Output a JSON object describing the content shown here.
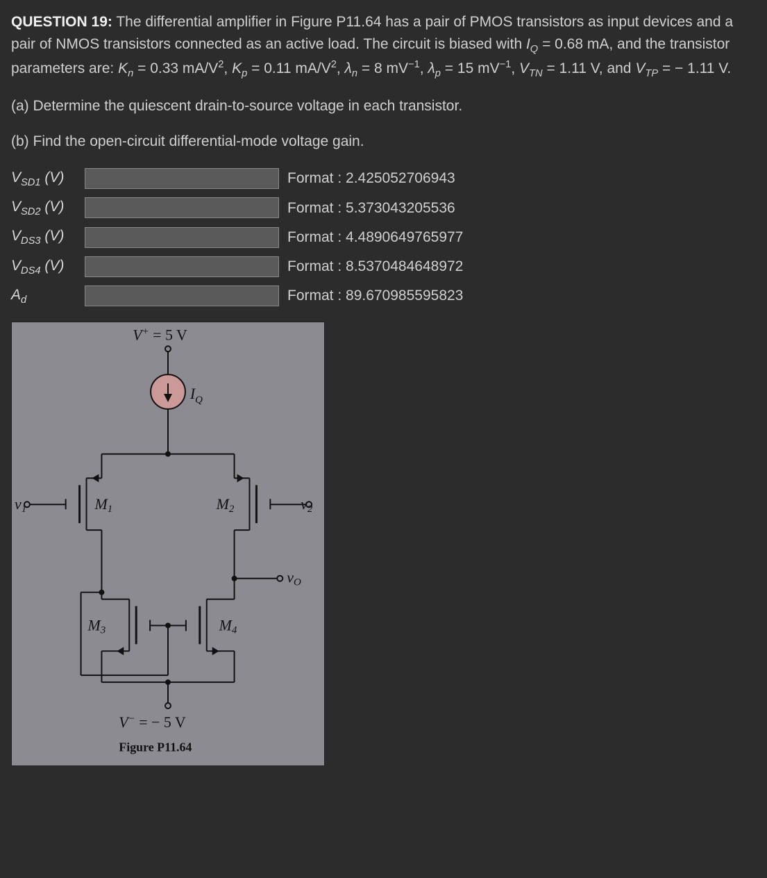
{
  "question": {
    "title": "QUESTION 19:",
    "intro": " The differential amplifier in Figure P11.64 has a pair of PMOS transistors as input devices and a pair of NMOS transistors connected as an active load. The circuit is biased with ",
    "iq_label": "I",
    "iq_sub": "Q",
    "iq_value": " = 0.68 mA, and the transistor parameters are: ",
    "kn_label": "K",
    "kn_sub": "n",
    "kn_value": " = 0.33 mA/V",
    "kp_label": "K",
    "kp_sub": "p",
    "kp_value": " = 0.11 mA/V",
    "ln_label": "λ",
    "ln_sub": "n",
    "ln_value": " = 8 mV",
    "lp_label": "λ",
    "lp_sub": "p",
    "lp_value": " = 15 mV",
    "vtn_label": "V",
    "vtn_sub": "TN",
    "vtn_value": " = 1.11 V, and ",
    "vtp_label": "V",
    "vtp_sub": "TP",
    "vtp_value": " = − 1.11 V.",
    "part_a": "(a) Determine the quiescent drain-to-source voltage in each transistor.",
    "part_b": "(b) Find the open-circuit differential-mode voltage gain."
  },
  "answers": [
    {
      "label_v": "V",
      "label_sub": "SD1",
      "unit": " (V)",
      "format": "Format : 2.425052706943"
    },
    {
      "label_v": "V",
      "label_sub": "SD2",
      "unit": " (V)",
      "format": "Format : 5.373043205536"
    },
    {
      "label_v": "V",
      "label_sub": "DS3",
      "unit": " (V)",
      "format": "Format : 4.4890649765977"
    },
    {
      "label_v": "V",
      "label_sub": "DS4",
      "unit": " (V)",
      "format": "Format : 8.5370484648972"
    },
    {
      "label_v": "A",
      "label_sub": "d",
      "unit": "",
      "format": "Format : 89.670985595823"
    }
  ],
  "figure": {
    "vplus": "V",
    "vplus_sup": "+",
    "vplus_val": " = 5 V",
    "iq": "I",
    "iq_sub": "Q",
    "m1": "M",
    "m1_sub": "1",
    "m2": "M",
    "m2_sub": "2",
    "m3": "M",
    "m3_sub": "3",
    "m4": "M",
    "m4_sub": "4",
    "v1": "v",
    "v1_sub": "1",
    "v2": "v",
    "v2_sub": "2",
    "vo": "v",
    "vo_sub": "O",
    "vminus": "V",
    "vminus_sup": "−",
    "vminus_val": " = − 5 V",
    "caption": "Figure P11.64"
  }
}
